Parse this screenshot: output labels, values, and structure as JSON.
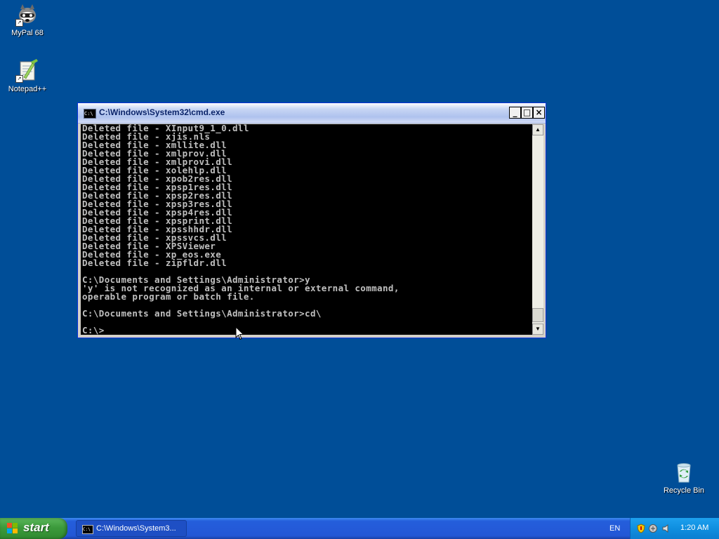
{
  "desktop": {
    "icons": [
      {
        "label": "MyPal 68"
      },
      {
        "label": "Notepad++"
      },
      {
        "label": "Recycle Bin"
      }
    ]
  },
  "window": {
    "title": "C:\\Windows\\System32\\cmd.exe",
    "buttons": {
      "minimize": "_",
      "maximize": "□",
      "close": "×"
    },
    "console_lines": [
      "Deleted file - XInput9_1_0.dll",
      "Deleted file - xjis.nls",
      "Deleted file - xmllite.dll",
      "Deleted file - xmlprov.dll",
      "Deleted file - xmlprovi.dll",
      "Deleted file - xolehlp.dll",
      "Deleted file - xpob2res.dll",
      "Deleted file - xpsp1res.dll",
      "Deleted file - xpsp2res.dll",
      "Deleted file - xpsp3res.dll",
      "Deleted file - xpsp4res.dll",
      "Deleted file - xpsprint.dll",
      "Deleted file - xpsshhdr.dll",
      "Deleted file - xpssvcs.dll",
      "Deleted file - XPSViewer",
      "Deleted file - xp_eos.exe",
      "Deleted file - zipfldr.dll",
      "",
      "C:\\Documents and Settings\\Administrator>y",
      "'y' is not recognized as an internal or external command,",
      "operable program or batch file.",
      "",
      "C:\\Documents and Settings\\Administrator>cd\\",
      "",
      "C:\\>"
    ]
  },
  "taskbar": {
    "start_label": "start",
    "task_label": "C:\\Windows\\System3...",
    "language": "EN",
    "clock": "1:20 AM"
  },
  "colors": {
    "desktop": "#004e98",
    "console_bg": "#000000",
    "console_fg": "#c0c0c0",
    "taskbar": "#245edb",
    "start": "#3c9a3c"
  }
}
